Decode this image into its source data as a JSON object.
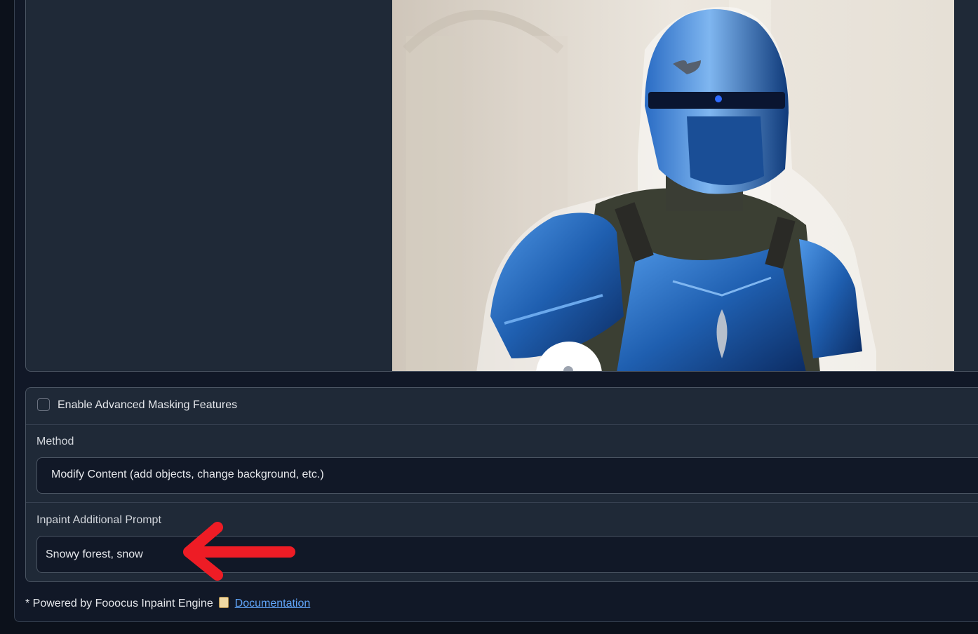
{
  "advanced_masking": {
    "label": "Enable Advanced Masking Features",
    "checked": false
  },
  "method": {
    "label": "Method",
    "selected": "Modify Content (add objects, change background, etc.)"
  },
  "inpaint_prompt": {
    "label": "Inpaint Additional Prompt",
    "value": "Snowy forest, snow"
  },
  "footer": {
    "note": "* Powered by Fooocus Inpaint Engine",
    "doc_icon": "scroll-icon",
    "doc_link": "Documentation"
  },
  "colors": {
    "annotation_arrow": "#ee1c25",
    "armor_blue": "#1f5fb0",
    "link": "#60a5fa"
  },
  "image": {
    "subject": "knight-in-blue-armor-photo"
  }
}
